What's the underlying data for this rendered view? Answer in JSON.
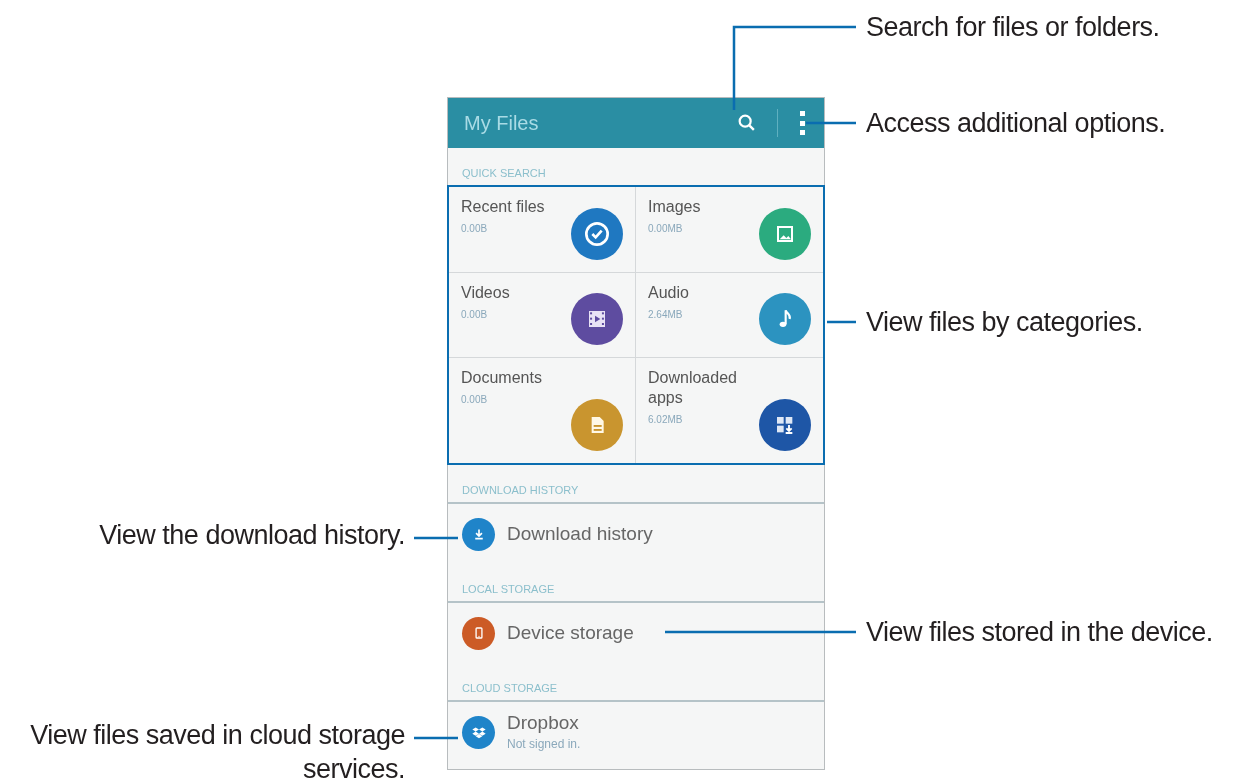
{
  "app_bar": {
    "title": "My Files"
  },
  "sections": [
    {
      "heading": "QUICK SEARCH",
      "kind": "grid",
      "items": [
        {
          "label": "Recent files",
          "size": "0.00B",
          "color": "#1f78c1"
        },
        {
          "label": "Images",
          "size": "0.00MB",
          "color": "#2bab7f"
        },
        {
          "label": "Videos",
          "size": "0.00B",
          "color": "#5e4ca0"
        },
        {
          "label": "Audio",
          "size": "2.64MB",
          "color": "#2c93c0"
        },
        {
          "label": "Documents",
          "size": "0.00B",
          "color": "#c9952f"
        },
        {
          "label": "Downloaded apps",
          "size": "6.02MB",
          "color": "#1e56a6"
        }
      ]
    },
    {
      "heading": "DOWNLOAD HISTORY",
      "kind": "list",
      "items": [
        {
          "label": "Download history",
          "color": "#1f84c9"
        }
      ]
    },
    {
      "heading": "LOCAL STORAGE",
      "kind": "list",
      "items": [
        {
          "label": "Device storage",
          "color": "#cc5b26"
        }
      ]
    },
    {
      "heading": "CLOUD STORAGE",
      "kind": "list",
      "items": [
        {
          "label": "Dropbox",
          "subtitle": "Not signed in.",
          "color": "#1f84c9"
        }
      ]
    }
  ],
  "callouts": [
    {
      "text": "Search for files or folders."
    },
    {
      "text": "Access additional options."
    },
    {
      "text": "View files by categories."
    },
    {
      "text": "View the download history."
    },
    {
      "text": "View files stored in the device."
    },
    {
      "text": "View files saved in cloud storage services."
    }
  ]
}
